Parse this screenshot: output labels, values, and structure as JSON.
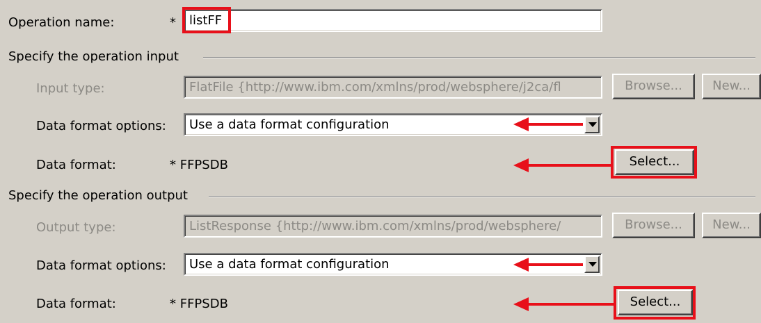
{
  "operation": {
    "name_label": "Operation name:",
    "required_marker": "*",
    "name_value": "listFF"
  },
  "input_section": {
    "title": "Specify the operation input",
    "type_label": "Input type:",
    "type_value": "FlatFile  {http://www.ibm.com/xmlns/prod/websphere/j2ca/fl",
    "browse_label": "Browse...",
    "new_label": "New...",
    "format_options_label": "Data format options:",
    "format_options_value": "Use a data format configuration",
    "data_format_label": "Data format:",
    "data_format_value": "* FFPSDB",
    "select_label": "Select..."
  },
  "output_section": {
    "title": "Specify the operation output",
    "type_label": "Output type:",
    "type_value": "ListResponse  {http://www.ibm.com/xmlns/prod/websphere/",
    "browse_label": "Browse...",
    "new_label": "New...",
    "format_options_label": "Data format options:",
    "format_options_value": "Use a data format configuration",
    "data_format_label": "Data format:",
    "data_format_value": "* FFPSDB",
    "select_label": "Select..."
  },
  "colors": {
    "background": "#d4d0c8",
    "highlight": "#e8101a",
    "disabled_text": "#8c8a85"
  },
  "icons": [
    "dropdown-arrow-icon",
    "red-arrow-annotation-icon"
  ]
}
